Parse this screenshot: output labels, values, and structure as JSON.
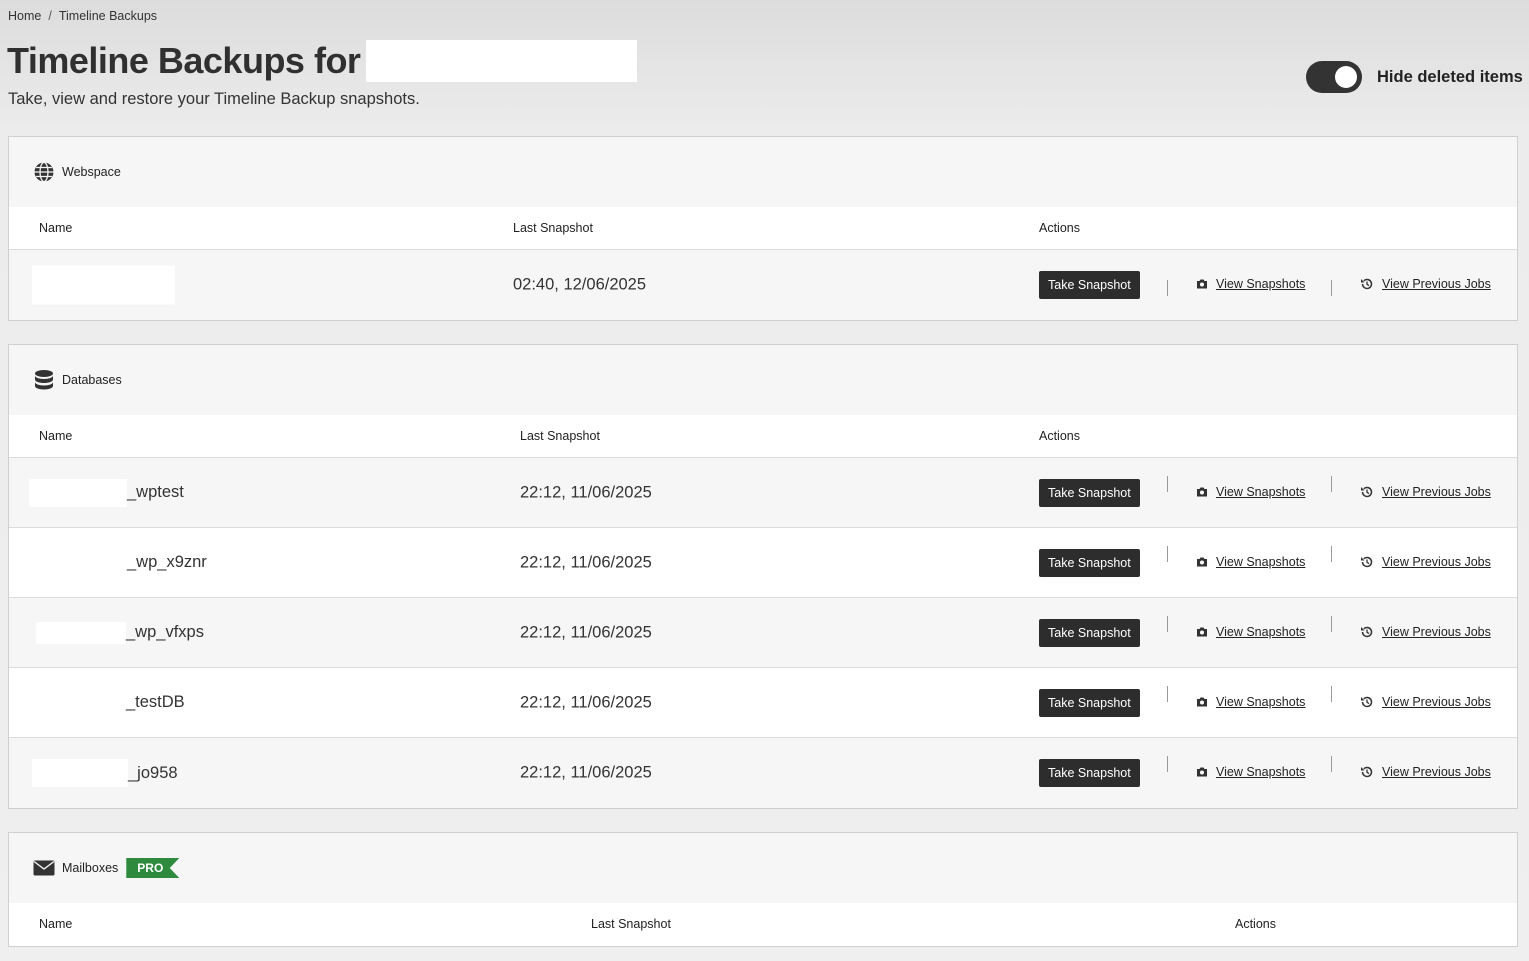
{
  "breadcrumb": {
    "home": "Home",
    "separator": "/",
    "current": "Timeline Backups"
  },
  "page": {
    "title": "Timeline Backups for",
    "subtitle": "Take, view and restore your Timeline Backup snapshots."
  },
  "toggle": {
    "label": "Hide deleted items",
    "on": true
  },
  "webspace": {
    "heading": "Webspace",
    "icon": "globe-icon",
    "columns": {
      "name": "Name",
      "last_snapshot": "Last Snapshot",
      "actions": "Actions"
    },
    "rows": [
      {
        "name": "",
        "last_snapshot": "02:40, 12/06/2025"
      }
    ]
  },
  "databases": {
    "heading": "Databases",
    "icon": "database-icon",
    "columns": {
      "name": "Name",
      "last_snapshot": "Last Snapshot",
      "actions": "Actions"
    },
    "rows": [
      {
        "name": "_wptest",
        "last_snapshot": "22:12, 11/06/2025"
      },
      {
        "name": "_wp_x9znr",
        "last_snapshot": "22:12, 11/06/2025"
      },
      {
        "name": "_wp_vfxps",
        "last_snapshot": "22:12, 11/06/2025"
      },
      {
        "name": "_testDB",
        "last_snapshot": "22:12, 11/06/2025"
      },
      {
        "name": "_jo958",
        "last_snapshot": "22:12, 11/06/2025"
      }
    ]
  },
  "mailboxes": {
    "heading": "Mailboxes",
    "icon": "envelope-icon",
    "badge": "PRO",
    "columns": {
      "name": "Name",
      "last_snapshot": "Last Snapshot",
      "actions": "Actions"
    }
  },
  "actions": {
    "take_snapshot": "Take Snapshot",
    "view_snapshots": "View Snapshots",
    "view_previous_jobs": "View Previous Jobs"
  },
  "colors": {
    "primary_dark": "#2d2d2d",
    "pro_green": "#2e8b3e"
  }
}
